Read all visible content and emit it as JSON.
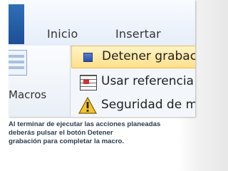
{
  "ribbon": {
    "tabs": [
      "Inicio",
      "Insertar"
    ]
  },
  "left_group": {
    "label": "Macros"
  },
  "menu": {
    "items": [
      {
        "label": "Detener grabaci",
        "icon": "stop-recording-icon"
      },
      {
        "label": "Usar referencia",
        "icon": "relative-reference-icon"
      },
      {
        "label": "Seguridad de m",
        "icon": "warning-icon"
      }
    ]
  },
  "caption": {
    "lines": [
      "Al terminar de ejecutar las acciones planeadas",
      "deberás pulsar el botón Detener",
      "grabación para completar la macro."
    ]
  }
}
